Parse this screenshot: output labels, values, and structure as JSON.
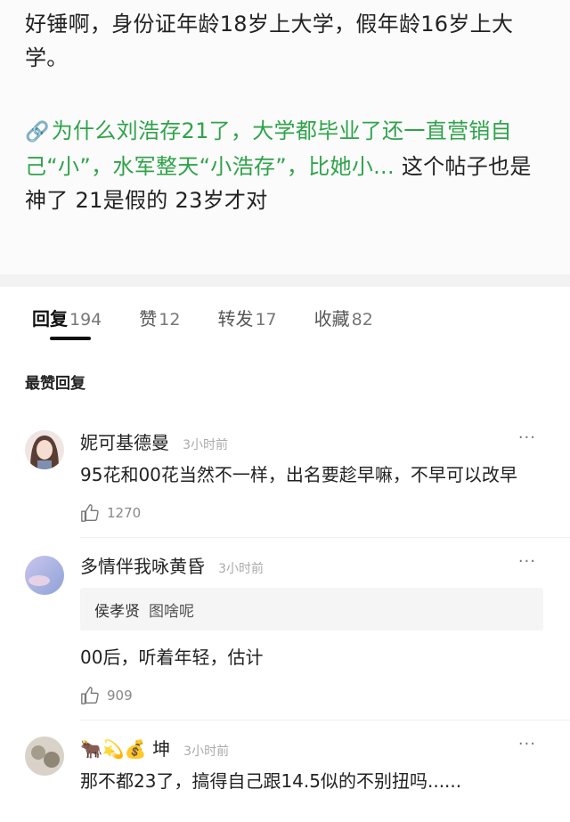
{
  "post": {
    "body_line": "好锤啊，身份证年龄18岁上大学，假年龄16岁上大学。",
    "link_icon": "link-icon",
    "link_text": "为什么刘浩存21了，大学都毕业了还一直营销自己“小”，水军整天“小浩存”，比她小...",
    "link_suffix": " 这个帖子也是神了 21是假的 23岁才对"
  },
  "tabs": [
    {
      "label": "回复",
      "count": "194",
      "active": true
    },
    {
      "label": "赞",
      "count": "12",
      "active": false
    },
    {
      "label": "转发",
      "count": "17",
      "active": false
    },
    {
      "label": "收藏",
      "count": "82",
      "active": false
    }
  ],
  "section_title": "最赞回复",
  "comments": [
    {
      "name": "妮可基德曼",
      "time": "3小时前",
      "text": "95花和00花当然不一样，出名要趁早嘛，不早可以改早",
      "likes": "1270"
    },
    {
      "name": "多情伴我咏黄昏",
      "time": "3小时前",
      "quote_name": "侯孝贤",
      "quote_text": "图啥呢",
      "text": "00后，听着年轻，估计",
      "likes": "909"
    },
    {
      "name": "🐂💫💰 坤",
      "time": "3小时前",
      "text": "那不都23了，搞得自己跟14.5似的不别扭吗......"
    }
  ],
  "more_label": "···",
  "colors": {
    "link": "#2fa34a",
    "muted": "#aaaaaa"
  }
}
